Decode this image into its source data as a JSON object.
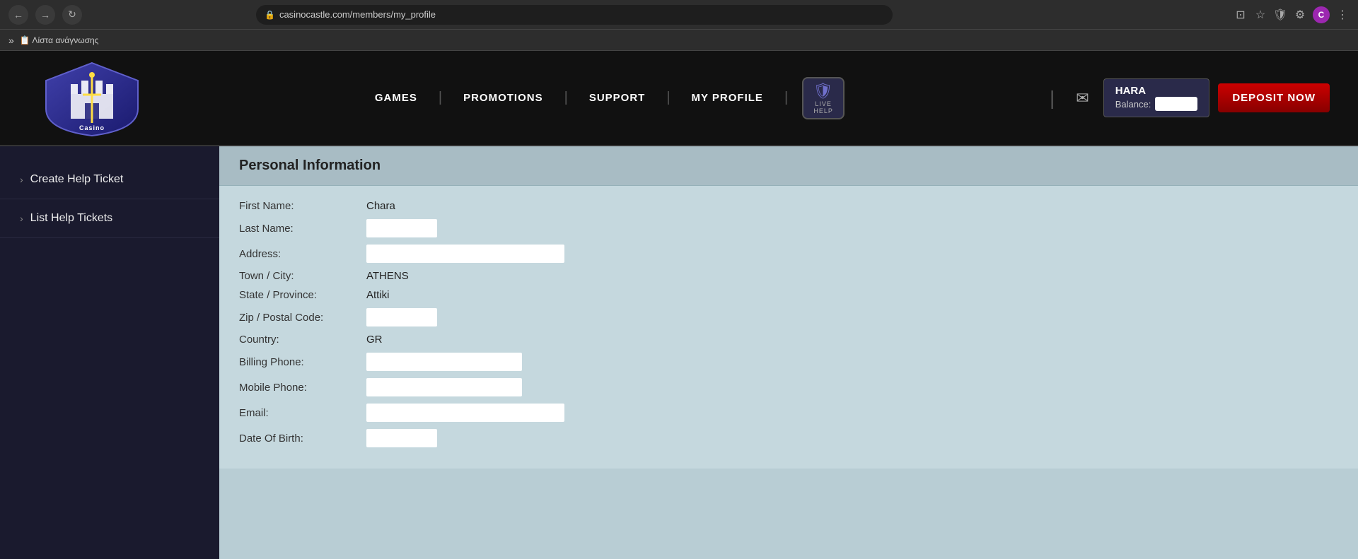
{
  "browser": {
    "back_label": "←",
    "forward_label": "→",
    "refresh_label": "↻",
    "url": "casinocastle.com/members/my_profile",
    "lock_icon": "🔒",
    "cast_icon": "⊡",
    "star_icon": "☆",
    "shield_icon": "🛡",
    "extensions_icon": "⚙",
    "avatar_label": "C",
    "menu_icon": "⋮",
    "bookmark_chevron": "»",
    "bookmark_label": "Λίστα ανάγνωσης"
  },
  "header": {
    "logo_text": "Casino Castle",
    "nav_items": [
      {
        "label": "GAMES",
        "id": "games"
      },
      {
        "label": "PROMOTIONS",
        "id": "promotions"
      },
      {
        "label": "SUPPORT",
        "id": "support"
      },
      {
        "label": "MY PROFILE",
        "id": "my-profile"
      }
    ],
    "live_help_top": "LIVE",
    "live_help_bottom": "HELP",
    "message_icon": "✉",
    "user": {
      "name": "HARA",
      "balance_label": "Balance:"
    },
    "deposit_label": "DEPOSIT NOW"
  },
  "sidebar": {
    "items": [
      {
        "label": "Create Help Ticket",
        "id": "create-help-ticket"
      },
      {
        "label": "List Help Tickets",
        "id": "list-help-tickets"
      }
    ]
  },
  "personal_info": {
    "section_title": "Personal Information",
    "fields": [
      {
        "label": "First Name:",
        "value": "Chara",
        "type": "text"
      },
      {
        "label": "Last Name:",
        "value": "",
        "type": "input_sm"
      },
      {
        "label": "Address:",
        "value": "",
        "type": "input_lg"
      },
      {
        "label": "Town / City:",
        "value": "ATHENS",
        "type": "text"
      },
      {
        "label": "State / Province:",
        "value": "Attiki",
        "type": "text"
      },
      {
        "label": "Zip / Postal Code:",
        "value": "",
        "type": "input_sm"
      },
      {
        "label": "Country:",
        "value": "GR",
        "type": "text"
      },
      {
        "label": "Billing Phone:",
        "value": "",
        "type": "input_md"
      },
      {
        "label": "Mobile Phone:",
        "value": "",
        "type": "input_md"
      },
      {
        "label": "Email:",
        "value": "",
        "type": "input_lg"
      },
      {
        "label": "Date Of Birth:",
        "value": "",
        "type": "input_sm"
      }
    ]
  }
}
